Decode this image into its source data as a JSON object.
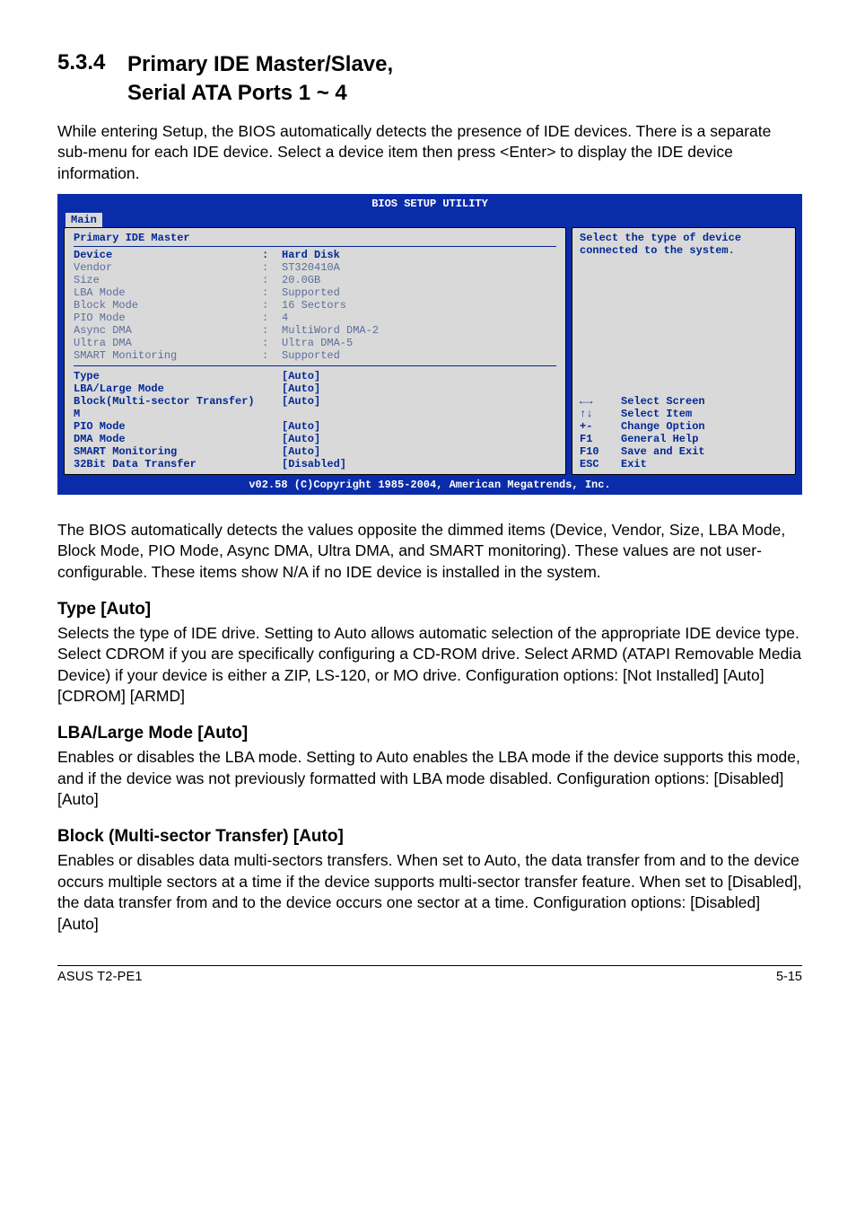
{
  "section": {
    "number": "5.3.4",
    "title_line1": "Primary IDE Master/Slave,",
    "title_line2": "Serial ATA Ports 1 ~ 4"
  },
  "intro": "While entering Setup, the BIOS automatically detects the presence of IDE devices. There is a separate sub-menu for each IDE device. Select a device item then press <Enter> to display the IDE device information.",
  "bios": {
    "header": "BIOS SETUP UTILITY",
    "tab": "Main",
    "panel_title": "Primary IDE Master",
    "info_rows": [
      {
        "label": "Device",
        "value": "Hard Disk",
        "bold": true
      },
      {
        "label": "Vendor",
        "value": "ST320410A",
        "bold": false
      },
      {
        "label": "Size",
        "value": "20.0GB",
        "bold": false
      },
      {
        "label": "LBA Mode",
        "value": "Supported",
        "bold": false
      },
      {
        "label": "Block Mode",
        "value": "16 Sectors",
        "bold": false
      },
      {
        "label": "PIO Mode",
        "value": "4",
        "bold": false
      },
      {
        "label": "Async DMA",
        "value": "MultiWord DMA-2",
        "bold": false
      },
      {
        "label": "Ultra DMA",
        "value": "Ultra DMA-5",
        "bold": false
      },
      {
        "label": "SMART Monitoring",
        "value": "Supported",
        "bold": false
      }
    ],
    "option_rows": [
      {
        "label": "Type",
        "value": "[Auto]"
      },
      {
        "label": "LBA/Large Mode",
        "value": "[Auto]"
      },
      {
        "label": "Block(Multi-sector Transfer) M",
        "value": "[Auto]"
      },
      {
        "label": "PIO Mode",
        "value": "[Auto]"
      },
      {
        "label": "DMA Mode",
        "value": "[Auto]"
      },
      {
        "label": "SMART Monitoring",
        "value": "[Auto]"
      },
      {
        "label": "32Bit Data Transfer",
        "value": "[Disabled]"
      }
    ],
    "help_text": "Select the type of device connected to the system.",
    "legend": [
      {
        "key_icon": "lr",
        "text": "Select Screen"
      },
      {
        "key_icon": "ud",
        "text": "Select Item"
      },
      {
        "key": "+-",
        "text": " Change Option"
      },
      {
        "key": "F1",
        "text": "General Help"
      },
      {
        "key": "F10",
        "text": "Save and Exit"
      },
      {
        "key": "ESC",
        "text": "Exit"
      }
    ],
    "footer": "v02.58 (C)Copyright 1985-2004, American Megatrends, Inc."
  },
  "para_after_bios": "The BIOS automatically detects the values opposite the dimmed items (Device, Vendor, Size, LBA Mode, Block Mode, PIO Mode, Async DMA, Ultra DMA, and SMART monitoring). These values are not user-configurable. These items show N/A if no IDE device is installed in the system.",
  "type": {
    "heading": "Type [Auto]",
    "text": "Selects the type of IDE drive. Setting to Auto allows automatic selection of the appropriate IDE device type. Select CDROM if you are specifically configuring a CD-ROM drive. Select ARMD (ATAPI Removable Media Device) if your device is either a ZIP, LS-120, or MO drive. Configuration options: [Not Installed] [Auto] [CDROM] [ARMD]"
  },
  "lba": {
    "heading": "LBA/Large Mode [Auto]",
    "text": "Enables or disables the LBA mode. Setting to Auto enables the LBA mode if the device supports this mode, and if the device was not previously formatted with LBA mode disabled. Configuration options: [Disabled] [Auto]"
  },
  "block": {
    "heading": "Block (Multi-sector Transfer) [Auto]",
    "text": "Enables or disables data multi-sectors transfers. When set to Auto, the data transfer from and to the device occurs multiple sectors at a time if the device supports multi-sector transfer feature. When set to [Disabled], the data transfer from and to the device occurs one sector at a time. Configuration options: [Disabled] [Auto]"
  },
  "footer": {
    "left": "ASUS T2-PE1",
    "right": "5-15"
  }
}
